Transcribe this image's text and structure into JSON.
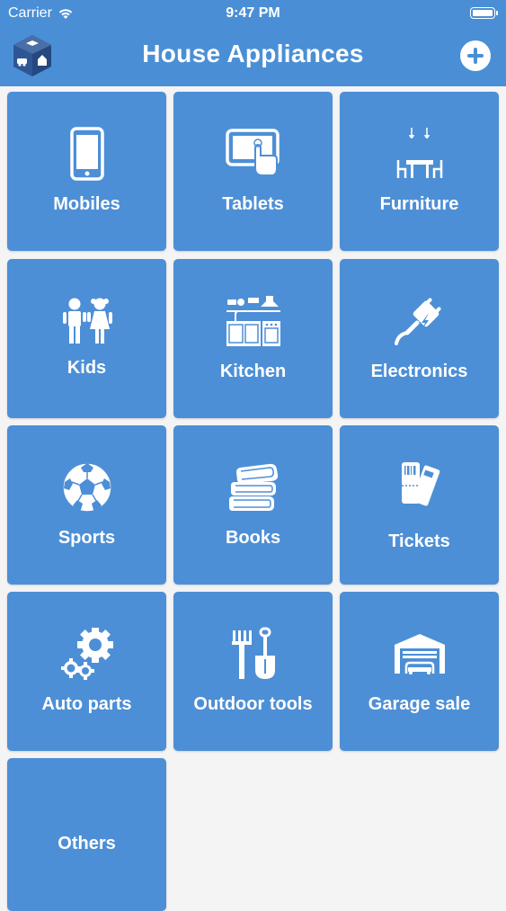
{
  "status_bar": {
    "carrier": "Carrier",
    "time": "9:47 PM"
  },
  "header": {
    "title": "House Appliances"
  },
  "categories": [
    {
      "label": "Mobiles",
      "icon": "mobile-phone-icon"
    },
    {
      "label": "Tablets",
      "icon": "tablet-touch-icon"
    },
    {
      "label": "Furniture",
      "icon": "dining-table-icon"
    },
    {
      "label": "Kids",
      "icon": "kids-icon"
    },
    {
      "label": "Kitchen",
      "icon": "kitchen-icon"
    },
    {
      "label": "Electronics",
      "icon": "electric-plug-icon"
    },
    {
      "label": "Sports",
      "icon": "soccer-ball-icon"
    },
    {
      "label": "Books",
      "icon": "books-icon"
    },
    {
      "label": "Tickets",
      "icon": "tickets-icon"
    },
    {
      "label": "Auto parts",
      "icon": "gears-icon"
    },
    {
      "label": "Outdoor tools",
      "icon": "garden-tools-icon"
    },
    {
      "label": "Garage sale",
      "icon": "garage-icon"
    },
    {
      "label": "Others",
      "icon": ""
    }
  ],
  "colors": {
    "header": "#4a8fd6",
    "tile": "#4d8fd6",
    "background": "#f4f4f4"
  }
}
